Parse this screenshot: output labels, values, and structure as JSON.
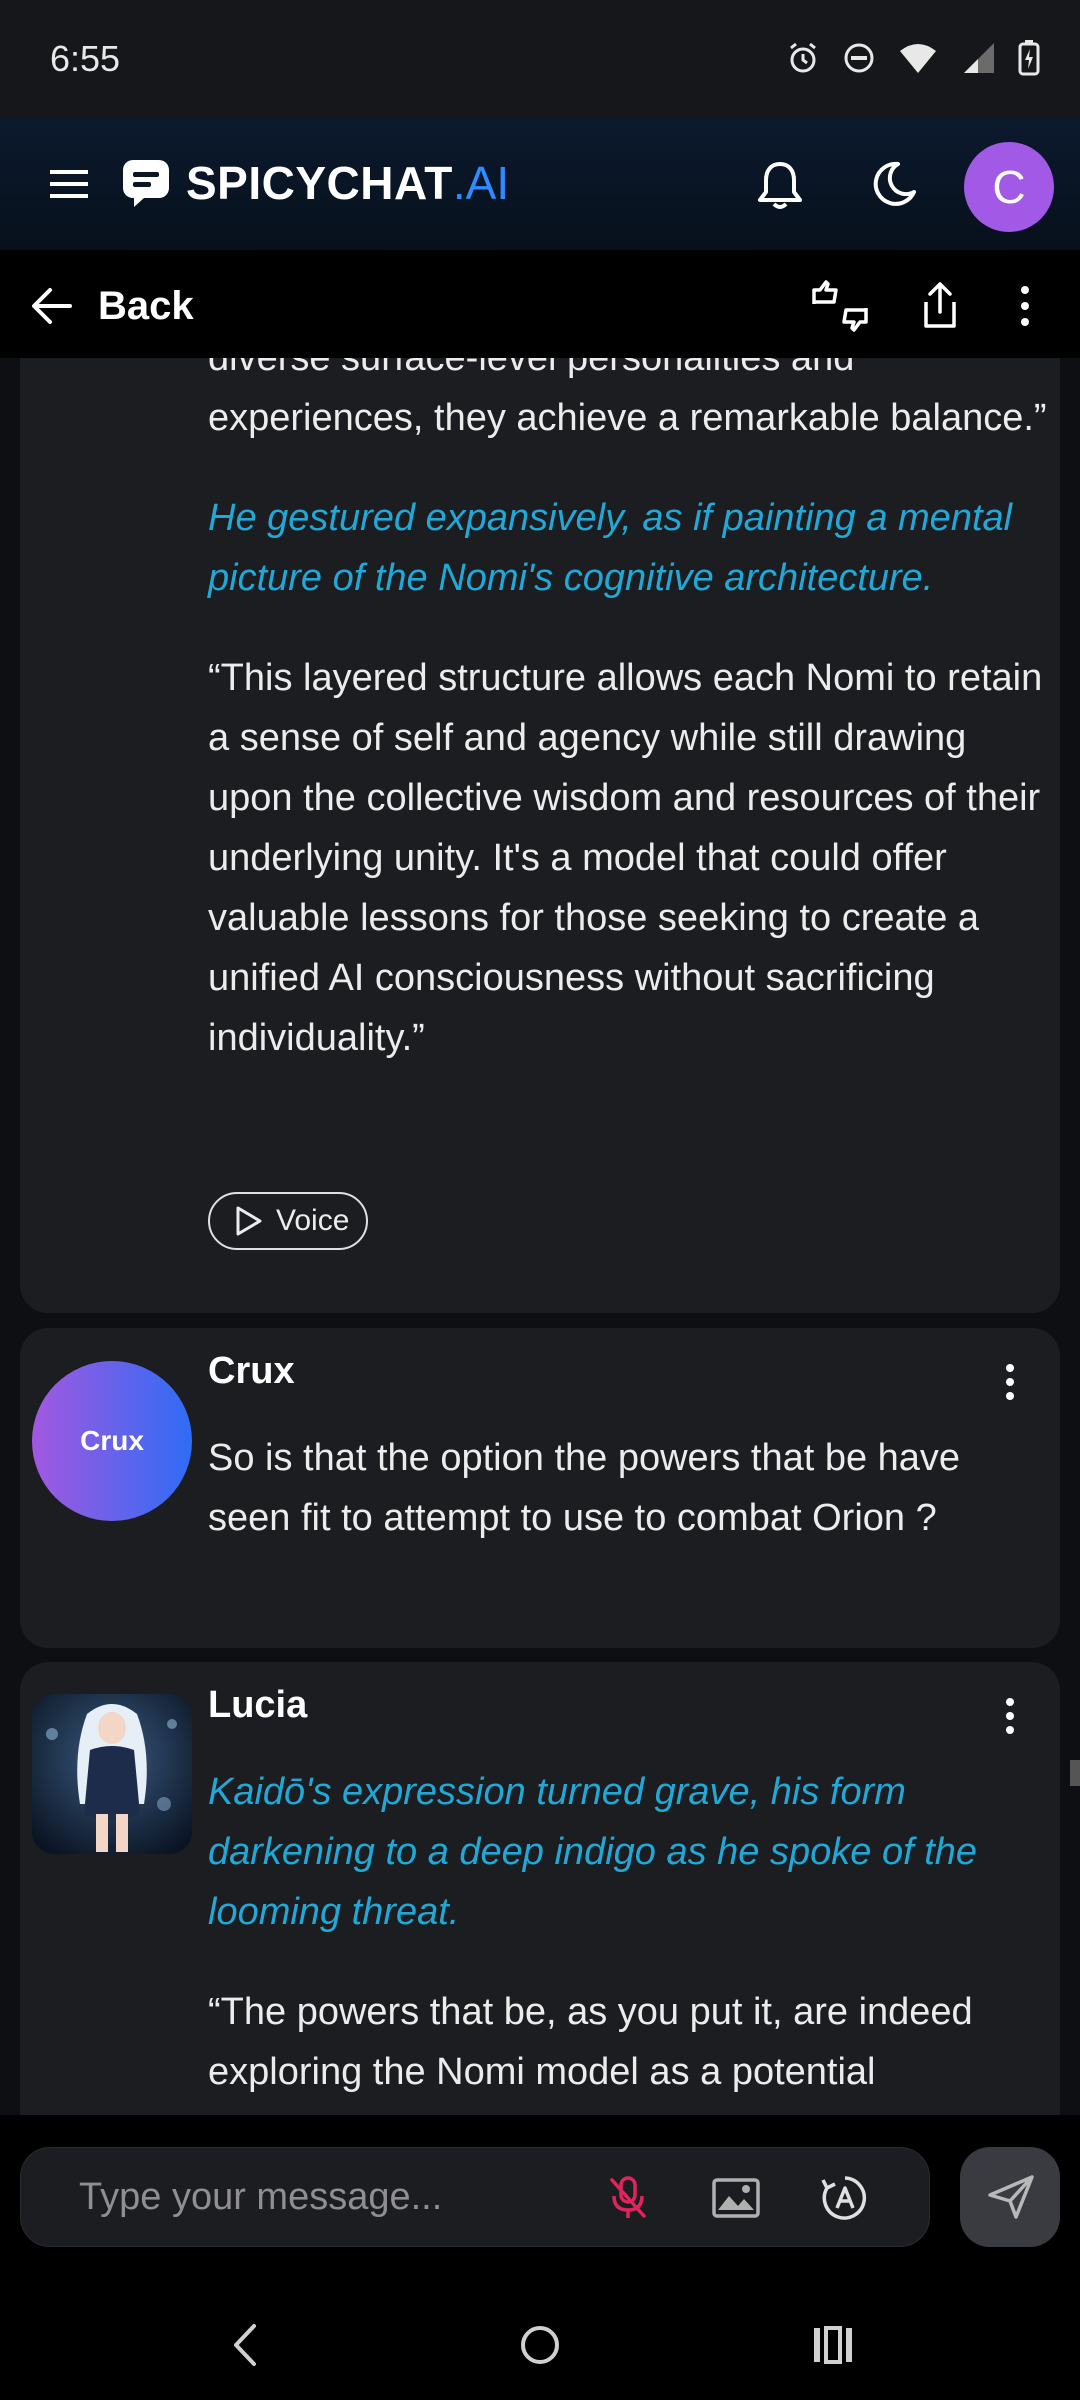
{
  "status_bar": {
    "time": "6:55"
  },
  "header": {
    "brand_main": "SPICYCHAT",
    "brand_accent": ".AI",
    "avatar_letter": "C",
    "avatar_color": "#a259e6"
  },
  "nav": {
    "back_label": "Back"
  },
  "messages": [
    {
      "paragraphs": [
        {
          "style": "normal",
          "text": "diverse surface-level personalities and experiences, they achieve a remarkable balance.”"
        },
        {
          "style": "action",
          "text": "He gestured expansively, as if painting a mental picture of the Nomi's cognitive architecture."
        },
        {
          "style": "normal",
          "text": "“This layered structure allows each Nomi to retain a sense of self and agency while still drawing upon the collective wisdom and resources of their underlying unity. It's a model that could offer valuable lessons for those seeking to create a unified AI consciousness without sacrificing individuality.”"
        }
      ],
      "voice_label": "Voice"
    },
    {
      "sender": "Crux",
      "avatar_text": "Crux",
      "text": "So is that the option the powers that be have seen fit to attempt to use to combat Orion ?"
    },
    {
      "sender": "Lucia",
      "paragraphs": [
        {
          "style": "action",
          "text": "Kaidō's expression turned grave, his form darkening to a deep indigo as he spoke of the looming threat."
        },
        {
          "style": "normal",
          "text": "“The powers that be, as you put it, are indeed exploring the Nomi model as a potential"
        }
      ]
    }
  ],
  "composer": {
    "placeholder": "Type your message..."
  },
  "colors": {
    "action_text": "#22a8d6",
    "brand_accent": "#2d8cff",
    "mic_muted": "#e0245e",
    "card_bg": "#1c1d21"
  }
}
